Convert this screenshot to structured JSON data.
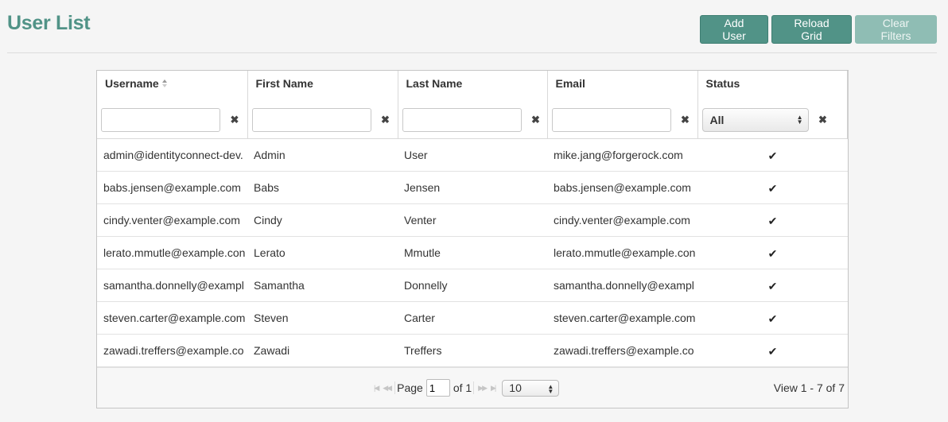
{
  "header": {
    "title": "User List",
    "buttons": {
      "add_user": "Add User",
      "reload_grid": "Reload Grid",
      "clear_filters": "Clear Filters"
    }
  },
  "grid": {
    "columns": [
      "Username",
      "First Name",
      "Last Name",
      "Email",
      "Status"
    ],
    "sort": {
      "column": "Username",
      "direction": "ascending"
    },
    "filters": {
      "username": "",
      "first_name": "",
      "last_name": "",
      "email": "",
      "status": "All"
    },
    "clear_glyph": "✖",
    "check_glyph": "✔",
    "rows": [
      {
        "username": "admin@identityconnect-dev.",
        "first_name": "Admin",
        "last_name": "User",
        "email": "mike.jang@forgerock.com",
        "status": "active"
      },
      {
        "username": "babs.jensen@example.com",
        "first_name": "Babs",
        "last_name": "Jensen",
        "email": "babs.jensen@example.com",
        "status": "active"
      },
      {
        "username": "cindy.venter@example.com",
        "first_name": "Cindy",
        "last_name": "Venter",
        "email": "cindy.venter@example.com",
        "status": "active"
      },
      {
        "username": "lerato.mmutle@example.con",
        "first_name": "Lerato",
        "last_name": "Mmutle",
        "email": "lerato.mmutle@example.con",
        "status": "active"
      },
      {
        "username": "samantha.donnelly@exampl",
        "first_name": "Samantha",
        "last_name": "Donnelly",
        "email": "samantha.donnelly@exampl",
        "status": "active"
      },
      {
        "username": "steven.carter@example.com",
        "first_name": "Steven",
        "last_name": "Carter",
        "email": "steven.carter@example.com",
        "status": "active"
      },
      {
        "username": "zawadi.treffers@example.co",
        "first_name": "Zawadi",
        "last_name": "Treffers",
        "email": "zawadi.treffers@example.co",
        "status": "active"
      }
    ]
  },
  "pager": {
    "page_label": "Page",
    "current_page": "1",
    "of_label": "of 1",
    "rows_per_page": "10",
    "view_text": "View 1 - 7 of 7"
  },
  "colors": {
    "accent": "#519387",
    "accent_disabled": "#8fbdb4"
  },
  "icons": [
    "sort-icon",
    "clear-filter-icon",
    "checkmark-icon",
    "first-page-icon",
    "prev-page-icon",
    "next-page-icon",
    "last-page-icon",
    "select-arrows-icon"
  ]
}
